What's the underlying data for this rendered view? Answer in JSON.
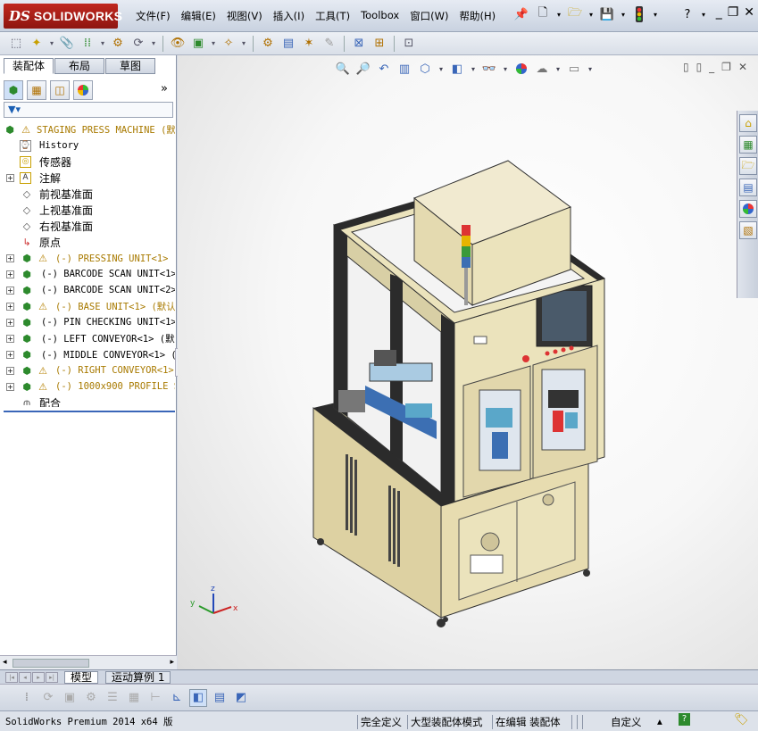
{
  "app": {
    "logo_ds": "DS",
    "logo_name": "SOLIDWORKS"
  },
  "menu": [
    "文件(F)",
    "编辑(E)",
    "视图(V)",
    "插入(I)",
    "工具(T)",
    "Toolbox",
    "窗口(W)",
    "帮助(H)"
  ],
  "title_icons": [
    "pin-icon",
    "new-document-icon",
    "open-icon",
    "save-icon",
    "traffic-light-icon",
    "help-icon"
  ],
  "window_controls": [
    "_",
    "❐",
    "✕"
  ],
  "panel_tabs": [
    "装配体",
    "布局",
    "草图"
  ],
  "panel_more": "»",
  "feature_tree": {
    "root": "STAGING PRESS MACHINE  (默",
    "items": [
      {
        "label": "History",
        "kind": "history"
      },
      {
        "label": "传感器",
        "kind": "sensor"
      },
      {
        "label": "注解",
        "kind": "annotation",
        "expand": "+"
      },
      {
        "label": "前视基准面",
        "kind": "plane"
      },
      {
        "label": "上视基准面",
        "kind": "plane"
      },
      {
        "label": "右视基准面",
        "kind": "plane"
      },
      {
        "label": "原点",
        "kind": "origin"
      },
      {
        "label": "(-) PRESSING UNIT<1> (默",
        "kind": "subasm",
        "warn": true,
        "expand": "+"
      },
      {
        "label": "(-) BARCODE SCAN UNIT<1>",
        "kind": "subasm",
        "warn": false,
        "expand": "+"
      },
      {
        "label": "(-) BARCODE SCAN UNIT<2>",
        "kind": "subasm",
        "warn": false,
        "expand": "+"
      },
      {
        "label": "(-) BASE UNIT<1> (默认",
        "kind": "subasm",
        "warn": true,
        "expand": "+"
      },
      {
        "label": "(-) PIN CHECKING UNIT<1>",
        "kind": "subasm",
        "warn": false,
        "expand": "+"
      },
      {
        "label": "(-) LEFT CONVEYOR<1> (默认",
        "kind": "subasm",
        "warn": false,
        "expand": "+"
      },
      {
        "label": "(-) MIDDLE CONVEYOR<1> (默",
        "kind": "subasm",
        "warn": false,
        "expand": "+"
      },
      {
        "label": "(-) RIGHT CONVEYOR<1>",
        "kind": "subasm",
        "warn": true,
        "expand": "+"
      },
      {
        "label": "(-) 1000x900 PROFILE ST",
        "kind": "subasm",
        "warn": true,
        "expand": "+"
      },
      {
        "label": "配合",
        "kind": "mates"
      }
    ]
  },
  "bottom_tabs": [
    "模型",
    "运动算例 1"
  ],
  "status": {
    "version": "SolidWorks Premium 2014 x64 版",
    "definition": "完全定义",
    "mode": "大型装配体模式",
    "editing": "在编辑 装配体",
    "custom": "自定义",
    "caret": "▴",
    "help_badge": "?"
  },
  "colors": {
    "accent": "#3a66b8",
    "machine_body": "#ebe3bc",
    "frame": "#2b2b2b",
    "warning": "#e0a800"
  }
}
